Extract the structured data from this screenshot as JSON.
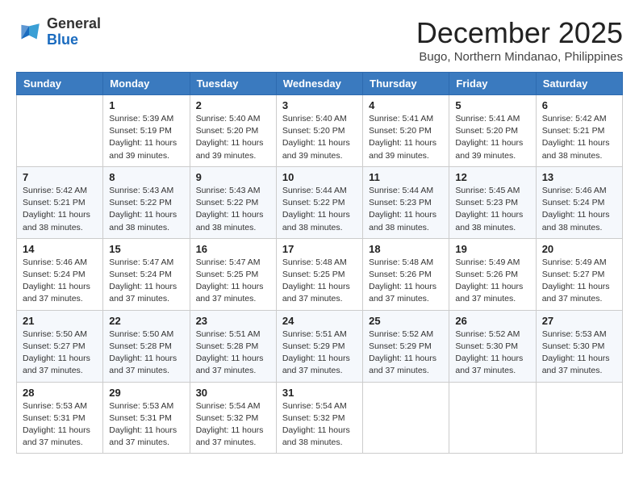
{
  "header": {
    "logo": {
      "general": "General",
      "blue": "Blue"
    },
    "title": "December 2025",
    "location": "Bugo, Northern Mindanao, Philippines"
  },
  "calendar": {
    "days_of_week": [
      "Sunday",
      "Monday",
      "Tuesday",
      "Wednesday",
      "Thursday",
      "Friday",
      "Saturday"
    ],
    "weeks": [
      [
        {
          "day": "",
          "info": ""
        },
        {
          "day": "1",
          "info": "Sunrise: 5:39 AM\nSunset: 5:19 PM\nDaylight: 11 hours\nand 39 minutes."
        },
        {
          "day": "2",
          "info": "Sunrise: 5:40 AM\nSunset: 5:20 PM\nDaylight: 11 hours\nand 39 minutes."
        },
        {
          "day": "3",
          "info": "Sunrise: 5:40 AM\nSunset: 5:20 PM\nDaylight: 11 hours\nand 39 minutes."
        },
        {
          "day": "4",
          "info": "Sunrise: 5:41 AM\nSunset: 5:20 PM\nDaylight: 11 hours\nand 39 minutes."
        },
        {
          "day": "5",
          "info": "Sunrise: 5:41 AM\nSunset: 5:20 PM\nDaylight: 11 hours\nand 39 minutes."
        },
        {
          "day": "6",
          "info": "Sunrise: 5:42 AM\nSunset: 5:21 PM\nDaylight: 11 hours\nand 38 minutes."
        }
      ],
      [
        {
          "day": "7",
          "info": "Sunrise: 5:42 AM\nSunset: 5:21 PM\nDaylight: 11 hours\nand 38 minutes."
        },
        {
          "day": "8",
          "info": "Sunrise: 5:43 AM\nSunset: 5:22 PM\nDaylight: 11 hours\nand 38 minutes."
        },
        {
          "day": "9",
          "info": "Sunrise: 5:43 AM\nSunset: 5:22 PM\nDaylight: 11 hours\nand 38 minutes."
        },
        {
          "day": "10",
          "info": "Sunrise: 5:44 AM\nSunset: 5:22 PM\nDaylight: 11 hours\nand 38 minutes."
        },
        {
          "day": "11",
          "info": "Sunrise: 5:44 AM\nSunset: 5:23 PM\nDaylight: 11 hours\nand 38 minutes."
        },
        {
          "day": "12",
          "info": "Sunrise: 5:45 AM\nSunset: 5:23 PM\nDaylight: 11 hours\nand 38 minutes."
        },
        {
          "day": "13",
          "info": "Sunrise: 5:46 AM\nSunset: 5:24 PM\nDaylight: 11 hours\nand 38 minutes."
        }
      ],
      [
        {
          "day": "14",
          "info": "Sunrise: 5:46 AM\nSunset: 5:24 PM\nDaylight: 11 hours\nand 37 minutes."
        },
        {
          "day": "15",
          "info": "Sunrise: 5:47 AM\nSunset: 5:24 PM\nDaylight: 11 hours\nand 37 minutes."
        },
        {
          "day": "16",
          "info": "Sunrise: 5:47 AM\nSunset: 5:25 PM\nDaylight: 11 hours\nand 37 minutes."
        },
        {
          "day": "17",
          "info": "Sunrise: 5:48 AM\nSunset: 5:25 PM\nDaylight: 11 hours\nand 37 minutes."
        },
        {
          "day": "18",
          "info": "Sunrise: 5:48 AM\nSunset: 5:26 PM\nDaylight: 11 hours\nand 37 minutes."
        },
        {
          "day": "19",
          "info": "Sunrise: 5:49 AM\nSunset: 5:26 PM\nDaylight: 11 hours\nand 37 minutes."
        },
        {
          "day": "20",
          "info": "Sunrise: 5:49 AM\nSunset: 5:27 PM\nDaylight: 11 hours\nand 37 minutes."
        }
      ],
      [
        {
          "day": "21",
          "info": "Sunrise: 5:50 AM\nSunset: 5:27 PM\nDaylight: 11 hours\nand 37 minutes."
        },
        {
          "day": "22",
          "info": "Sunrise: 5:50 AM\nSunset: 5:28 PM\nDaylight: 11 hours\nand 37 minutes."
        },
        {
          "day": "23",
          "info": "Sunrise: 5:51 AM\nSunset: 5:28 PM\nDaylight: 11 hours\nand 37 minutes."
        },
        {
          "day": "24",
          "info": "Sunrise: 5:51 AM\nSunset: 5:29 PM\nDaylight: 11 hours\nand 37 minutes."
        },
        {
          "day": "25",
          "info": "Sunrise: 5:52 AM\nSunset: 5:29 PM\nDaylight: 11 hours\nand 37 minutes."
        },
        {
          "day": "26",
          "info": "Sunrise: 5:52 AM\nSunset: 5:30 PM\nDaylight: 11 hours\nand 37 minutes."
        },
        {
          "day": "27",
          "info": "Sunrise: 5:53 AM\nSunset: 5:30 PM\nDaylight: 11 hours\nand 37 minutes."
        }
      ],
      [
        {
          "day": "28",
          "info": "Sunrise: 5:53 AM\nSunset: 5:31 PM\nDaylight: 11 hours\nand 37 minutes."
        },
        {
          "day": "29",
          "info": "Sunrise: 5:53 AM\nSunset: 5:31 PM\nDaylight: 11 hours\nand 37 minutes."
        },
        {
          "day": "30",
          "info": "Sunrise: 5:54 AM\nSunset: 5:32 PM\nDaylight: 11 hours\nand 37 minutes."
        },
        {
          "day": "31",
          "info": "Sunrise: 5:54 AM\nSunset: 5:32 PM\nDaylight: 11 hours\nand 38 minutes."
        },
        {
          "day": "",
          "info": ""
        },
        {
          "day": "",
          "info": ""
        },
        {
          "day": "",
          "info": ""
        }
      ]
    ]
  }
}
